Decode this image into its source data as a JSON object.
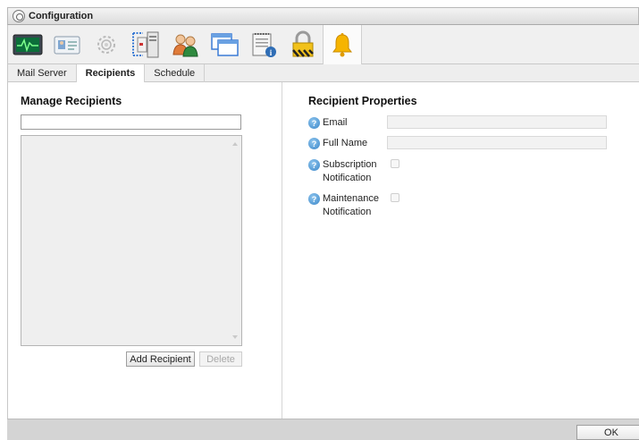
{
  "window": {
    "title": "Configuration"
  },
  "toolbar": {
    "icons": [
      {
        "name": "monitor-pulse-icon",
        "active": false
      },
      {
        "name": "user-card-icon",
        "active": false
      },
      {
        "name": "gear-icon",
        "active": false
      },
      {
        "name": "server-network-icon",
        "active": false
      },
      {
        "name": "users-icon",
        "active": false
      },
      {
        "name": "windows-icon",
        "active": false
      },
      {
        "name": "notepad-info-icon",
        "active": false
      },
      {
        "name": "lock-icon",
        "active": false
      },
      {
        "name": "bell-icon",
        "active": true
      }
    ]
  },
  "tabs": [
    {
      "label": "Mail Server",
      "active": false
    },
    {
      "label": "Recipients",
      "active": true
    },
    {
      "label": "Schedule",
      "active": false
    }
  ],
  "manage": {
    "title": "Manage Recipients",
    "search_value": "",
    "add_button": "Add Recipient",
    "delete_button": "Delete"
  },
  "properties": {
    "title": "Recipient Properties",
    "email_label": "Email",
    "email_value": "",
    "fullname_label": "Full Name",
    "fullname_value": "",
    "subscription_label": "Subscription Notification",
    "maintenance_label": "Maintenance Notification",
    "help_glyph": "?"
  },
  "footer": {
    "ok_button": "OK"
  },
  "colors": {
    "accent_bell": "#f6b400",
    "help_blue": "#3a86c8"
  }
}
